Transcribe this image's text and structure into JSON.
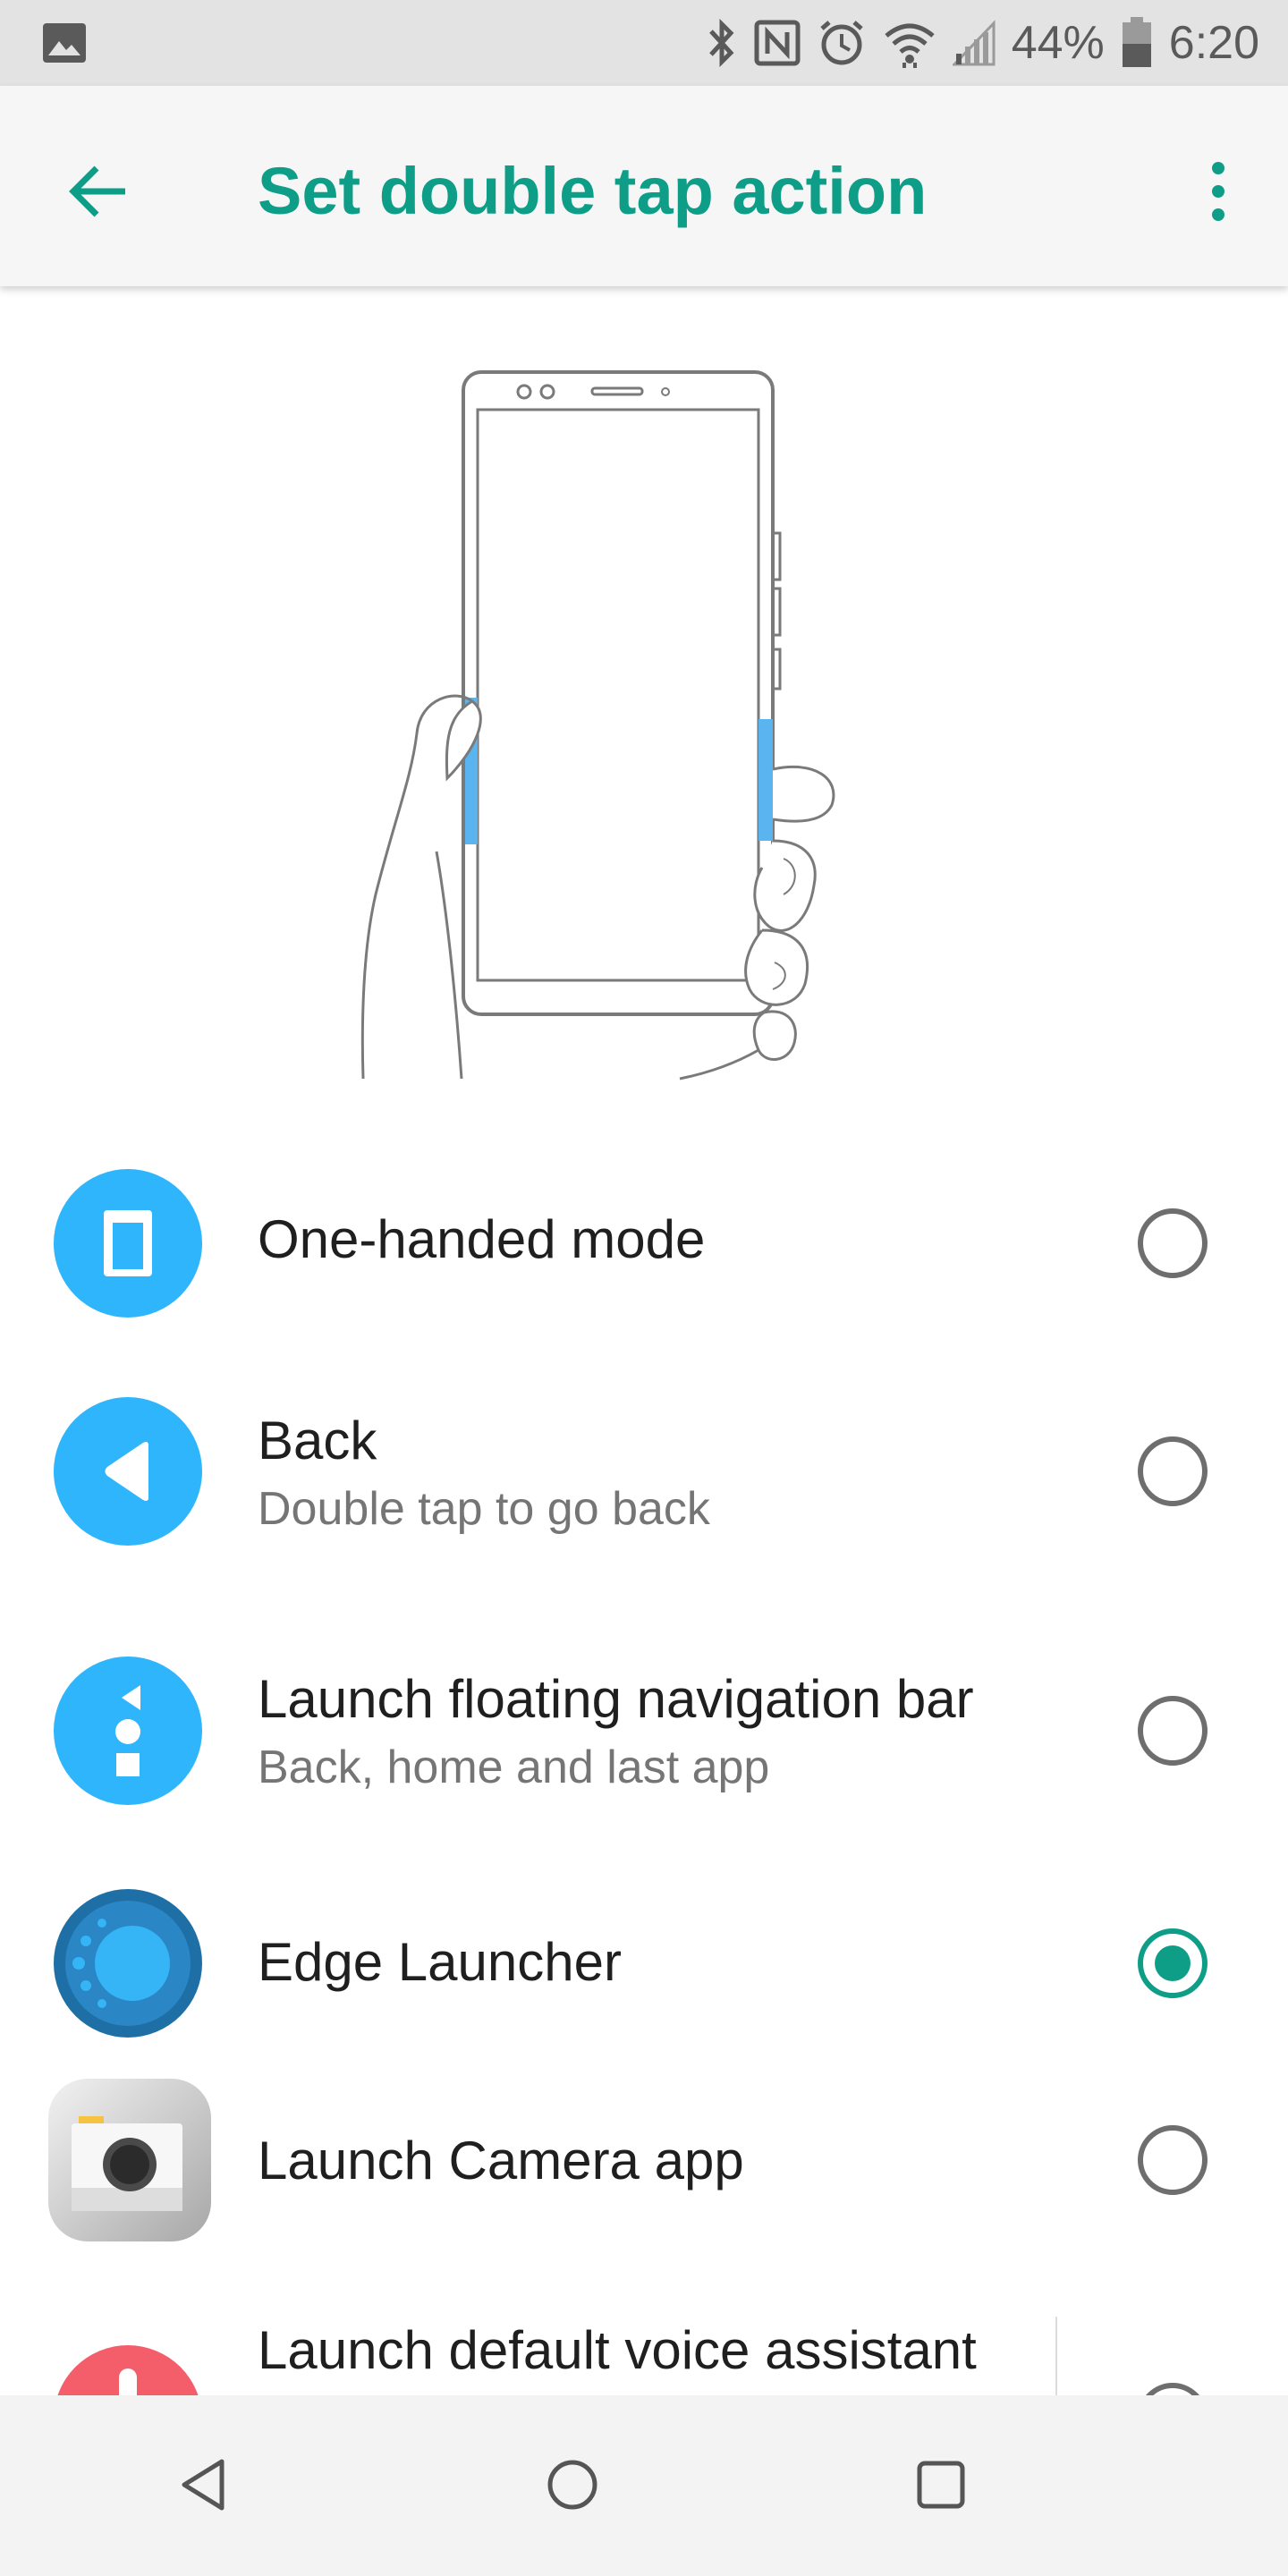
{
  "status_bar": {
    "battery_percent": "44%",
    "time": "6:20",
    "icons": [
      "image-icon",
      "bluetooth-icon",
      "nfc-icon",
      "alarm-icon",
      "wifi-icon",
      "signal-icon",
      "battery-icon"
    ]
  },
  "app_bar": {
    "title": "Set double tap action",
    "back_icon": "arrow-back-icon",
    "menu_icon": "more-vert-icon"
  },
  "options": [
    {
      "title": "One-handed mode",
      "subtitle": "",
      "icon": "one-handed-mode-icon",
      "selected": false
    },
    {
      "title": "Back",
      "subtitle": "Double tap to go back",
      "icon": "back-triangle-icon",
      "selected": false
    },
    {
      "title": "Launch floating navigation bar",
      "subtitle": "Back, home and last app",
      "icon": "floating-nav-icon",
      "selected": false
    },
    {
      "title": "Edge Launcher",
      "subtitle": "",
      "icon": "edge-launcher-icon",
      "selected": true
    },
    {
      "title": "Launch Camera app",
      "subtitle": "",
      "icon": "camera-app-icon",
      "selected": false
    },
    {
      "title": "Launch default voice assistant",
      "subtitle": "",
      "icon": "voice-assistant-icon",
      "selected": false
    }
  ],
  "colors": {
    "accent": "#0e9e88",
    "icon_blue": "#2fb5fb",
    "edge_blue": "#1e6fa6",
    "voice_red": "#f45d6a"
  },
  "nav_bar": {
    "back": "nav-back-icon",
    "home": "nav-home-icon",
    "recents": "nav-recents-icon"
  }
}
